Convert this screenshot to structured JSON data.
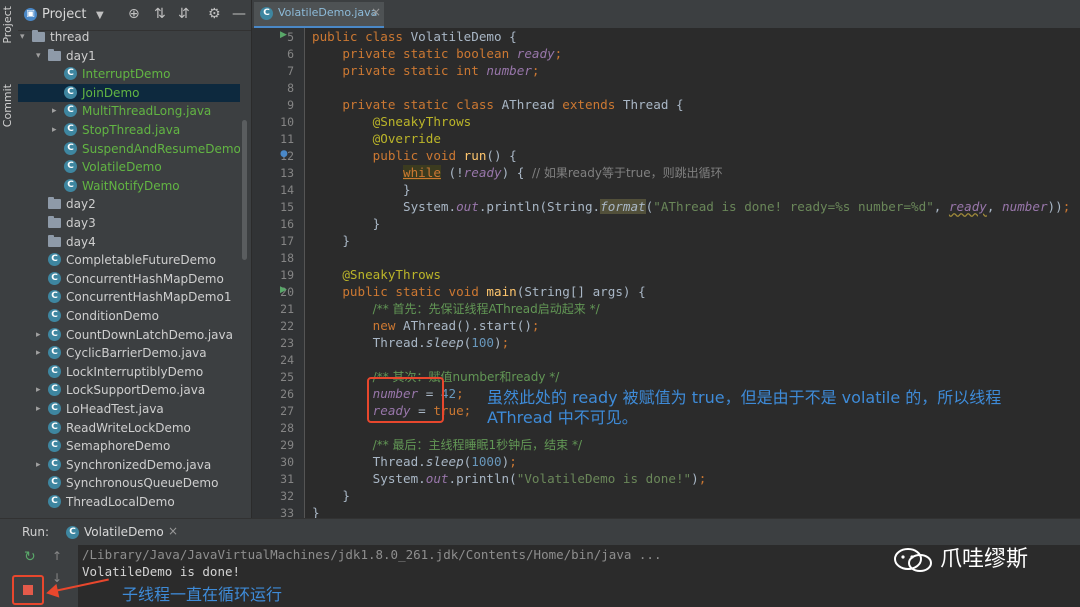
{
  "sidebar": {
    "project_label": "Project",
    "commit_label": "Commit"
  },
  "project_panel": {
    "title": "Project",
    "tree": [
      {
        "label": "thread",
        "type": "folder",
        "indent": 0,
        "arrow": "down",
        "selected": false,
        "color": "#cfcfcf"
      },
      {
        "label": "day1",
        "type": "folder",
        "indent": 1,
        "arrow": "down",
        "selected": false,
        "color": "#cfcfcf"
      },
      {
        "label": "InterruptDemo",
        "type": "class",
        "indent": 2,
        "arrow": "",
        "selected": false,
        "color": "#62b543"
      },
      {
        "label": "JoinDemo",
        "type": "class",
        "indent": 2,
        "arrow": "",
        "selected": true,
        "color": "#62b543"
      },
      {
        "label": "MultiThreadLong.java",
        "type": "class",
        "indent": 2,
        "arrow": "right",
        "selected": false,
        "color": "#62b543"
      },
      {
        "label": "StopThread.java",
        "type": "class",
        "indent": 2,
        "arrow": "right",
        "selected": false,
        "color": "#62b543"
      },
      {
        "label": "SuspendAndResumeDemo",
        "type": "class",
        "indent": 2,
        "arrow": "",
        "selected": false,
        "color": "#62b543"
      },
      {
        "label": "VolatileDemo",
        "type": "class",
        "indent": 2,
        "arrow": "",
        "selected": false,
        "color": "#62b543"
      },
      {
        "label": "WaitNotifyDemo",
        "type": "class",
        "indent": 2,
        "arrow": "",
        "selected": false,
        "color": "#62b543"
      },
      {
        "label": "day2",
        "type": "folder",
        "indent": 1,
        "arrow": "",
        "selected": false,
        "color": "#cfcfcf"
      },
      {
        "label": "day3",
        "type": "folder",
        "indent": 1,
        "arrow": "",
        "selected": false,
        "color": "#cfcfcf"
      },
      {
        "label": "day4",
        "type": "folder",
        "indent": 1,
        "arrow": "",
        "selected": false,
        "color": "#cfcfcf"
      },
      {
        "label": "CompletableFutureDemo",
        "type": "class",
        "indent": 1,
        "arrow": "",
        "selected": false,
        "color": "#cfcfcf"
      },
      {
        "label": "ConcurrentHashMapDemo",
        "type": "class",
        "indent": 1,
        "arrow": "",
        "selected": false,
        "color": "#cfcfcf"
      },
      {
        "label": "ConcurrentHashMapDemo1",
        "type": "class",
        "indent": 1,
        "arrow": "",
        "selected": false,
        "color": "#cfcfcf"
      },
      {
        "label": "ConditionDemo",
        "type": "class",
        "indent": 1,
        "arrow": "",
        "selected": false,
        "color": "#cfcfcf"
      },
      {
        "label": "CountDownLatchDemo.java",
        "type": "class",
        "indent": 1,
        "arrow": "right",
        "selected": false,
        "color": "#cfcfcf"
      },
      {
        "label": "CyclicBarrierDemo.java",
        "type": "class",
        "indent": 1,
        "arrow": "right",
        "selected": false,
        "color": "#cfcfcf"
      },
      {
        "label": "LockInterruptiblyDemo",
        "type": "class",
        "indent": 1,
        "arrow": "",
        "selected": false,
        "color": "#cfcfcf"
      },
      {
        "label": "LockSupportDemo.java",
        "type": "class",
        "indent": 1,
        "arrow": "right",
        "selected": false,
        "color": "#cfcfcf"
      },
      {
        "label": "LoHeadTest.java",
        "type": "class",
        "indent": 1,
        "arrow": "right",
        "selected": false,
        "color": "#cfcfcf"
      },
      {
        "label": "ReadWriteLockDemo",
        "type": "class",
        "indent": 1,
        "arrow": "",
        "selected": false,
        "color": "#cfcfcf"
      },
      {
        "label": "SemaphoreDemo",
        "type": "class",
        "indent": 1,
        "arrow": "",
        "selected": false,
        "color": "#cfcfcf"
      },
      {
        "label": "SynchronizedDemo.java",
        "type": "class",
        "indent": 1,
        "arrow": "right",
        "selected": false,
        "color": "#cfcfcf"
      },
      {
        "label": "SynchronousQueueDemo",
        "type": "class",
        "indent": 1,
        "arrow": "",
        "selected": false,
        "color": "#cfcfcf"
      },
      {
        "label": "ThreadLocalDemo",
        "type": "class",
        "indent": 1,
        "arrow": "",
        "selected": false,
        "color": "#cfcfcf"
      }
    ]
  },
  "editor": {
    "tab_label": "VolatileDemo.java",
    "line_numbers": [
      "5",
      "6",
      "7",
      "8",
      "9",
      "10",
      "11",
      "12",
      "13",
      "14",
      "15",
      "16",
      "17",
      "18",
      "19",
      "20",
      "21",
      "22",
      "23",
      "24",
      "25",
      "26",
      "27",
      "28",
      "29",
      "30",
      "31",
      "32",
      "33"
    ],
    "comments": {
      "while_comment": "// 如果ready等于true，则跳出循环",
      "doc1": "/** 首先：先保证线程AThread启动起来 */",
      "doc2": "/** 其次：赋值number和ready */",
      "doc3": "/** 最后：主线程睡眠1秒钟后，结束 */"
    },
    "strings": {
      "format_string": "\"AThread is done! ready=%s number=%d\"",
      "done_string": "\"VolatileDemo is done!\""
    },
    "numbers": {
      "sleep1": "100",
      "assign": "42",
      "sleep2": "1000"
    }
  },
  "annotation": {
    "callout_text": "虽然此处的 ready 被赋值为 true，但是由于不是 volatile 的，所以线程 AThread 中不可见。",
    "bottom_note": "子线程一直在循环运行",
    "accent_color": "#3e8bd8",
    "box_color": "#e8472d"
  },
  "run_panel": {
    "run_label": "Run:",
    "tab_label": "VolatileDemo",
    "console_lines": [
      "/Library/Java/JavaVirtualMachines/jdk1.8.0_261.jdk/Contents/Home/bin/java ...",
      "VolatileDemo is done!"
    ]
  },
  "watermark": {
    "text": "爪哇缪斯"
  }
}
